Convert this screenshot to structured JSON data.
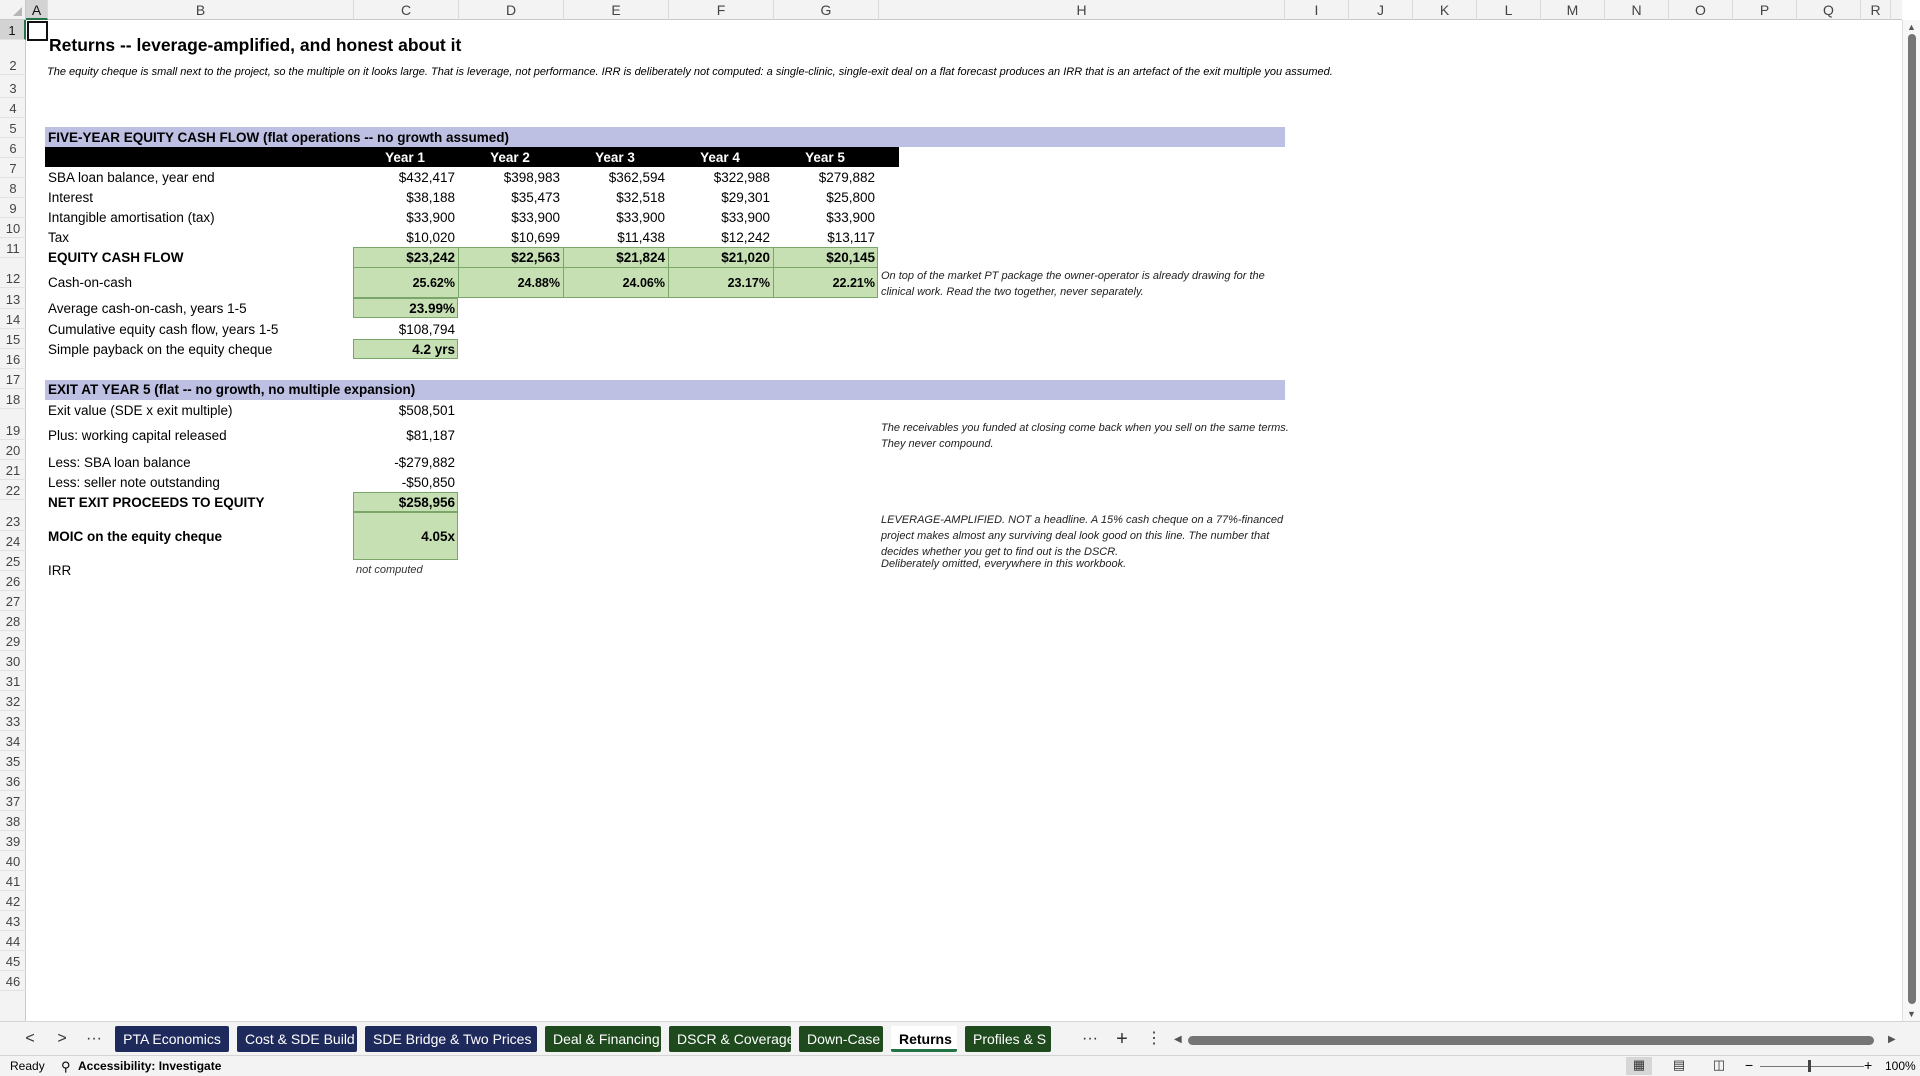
{
  "sheet": {
    "columns": [
      "A",
      "B",
      "C",
      "D",
      "E",
      "F",
      "G",
      "H",
      "I",
      "J",
      "K",
      "L",
      "M",
      "N",
      "O",
      "P",
      "Q",
      "R"
    ],
    "rows": [
      "1",
      "2",
      "3",
      "4",
      "5",
      "6",
      "7",
      "8",
      "9",
      "10",
      "11",
      "12",
      "13",
      "14",
      "15",
      "16",
      "17",
      "18",
      "19",
      "20",
      "21",
      "22",
      "23",
      "24",
      "25",
      "26",
      "27",
      "28",
      "29",
      "30",
      "31",
      "32",
      "33",
      "34",
      "35",
      "36",
      "37",
      "38",
      "39",
      "40",
      "41",
      "42",
      "43",
      "44",
      "45",
      "46"
    ],
    "title": "Returns -- leverage-amplified, and honest about it",
    "intro": "The equity cheque is small next to the project, so the multiple on it looks large. That is leverage, not performance. IRR is deliberately not computed: a single-clinic, single-exit deal on a flat forecast produces an IRR that is an artefact of the exit multiple you assumed.",
    "cash_flow": {
      "section_title": "FIVE-YEAR EQUITY CASH FLOW  (flat operations -- no growth assumed)",
      "years": [
        "Year 1",
        "Year 2",
        "Year 3",
        "Year 4",
        "Year 5"
      ],
      "rows": [
        {
          "label": "SBA loan balance, year end",
          "values": [
            "$432,417",
            "$398,983",
            "$362,594",
            "$322,988",
            "$279,882"
          ]
        },
        {
          "label": "Interest",
          "values": [
            "$38,188",
            "$35,473",
            "$32,518",
            "$29,301",
            "$25,800"
          ]
        },
        {
          "label": "Intangible amortisation (tax)",
          "values": [
            "$33,900",
            "$33,900",
            "$33,900",
            "$33,900",
            "$33,900"
          ]
        },
        {
          "label": "Tax",
          "values": [
            "$10,020",
            "$10,699",
            "$11,438",
            "$12,242",
            "$13,117"
          ]
        },
        {
          "label": "EQUITY CASH FLOW",
          "values": [
            "$23,242",
            "$22,563",
            "$21,824",
            "$21,020",
            "$20,145"
          ]
        },
        {
          "label": "Cash-on-cash",
          "values": [
            "25.62%",
            "24.88%",
            "24.06%",
            "23.17%",
            "22.21%"
          ]
        }
      ],
      "coc_note": "On top of the market PT package the owner-operator is already drawing for the clinical work. Read the two together, never separately.",
      "avg_label": "Average cash-on-cash, years 1-5",
      "avg_value": "23.99%",
      "cum_label": "Cumulative equity cash flow, years 1-5",
      "cum_value": "$108,794",
      "payback_label": "Simple payback on the equity cheque",
      "payback_value": "4.2 yrs"
    },
    "exit": {
      "section_title": "EXIT AT YEAR 5  (flat -- no growth, no multiple expansion)",
      "exit_value_label": "Exit value (SDE x exit multiple)",
      "exit_value": "$508,501",
      "wc_label": "Plus: working capital released",
      "wc_value": "$81,187",
      "wc_note": "The receivables you funded at closing come back when you sell on the same terms. They never compound.",
      "sba_label": "Less: SBA loan balance",
      "sba_value": "-$279,882",
      "seller_label": "Less: seller note outstanding",
      "seller_value": "-$50,850",
      "net_label": "NET EXIT PROCEEDS TO EQUITY",
      "net_value": "$258,956",
      "moic_label": "MOIC on the equity cheque",
      "moic_value": "4.05x",
      "moic_note": "LEVERAGE-AMPLIFIED. NOT a headline. A 15% cash cheque on a 77%-financed project makes almost any surviving deal look good on this line. The number that decides whether you get to find out is the DSCR.",
      "irr_label": "IRR",
      "irr_value": "not computed",
      "irr_note": "Deliberately omitted, everywhere in this workbook."
    }
  },
  "tabs": [
    {
      "label": "PTA Economics",
      "color": "#1f2a5c"
    },
    {
      "label": "Cost & SDE Build",
      "color": "#1f2a5c"
    },
    {
      "label": "SDE Bridge & Two Prices",
      "color": "#1f2a5c"
    },
    {
      "label": "Deal & Financing",
      "color": "#1e4a1e"
    },
    {
      "label": "DSCR & Coverage",
      "color": "#1e4a1e"
    },
    {
      "label": "Down-Case",
      "color": "#1e4a1e"
    },
    {
      "label": "Returns",
      "color": "#1e4a1e"
    },
    {
      "label": "Profiles & S",
      "color": "#1e4a1e"
    }
  ],
  "tab_nav": {
    "prev": "<",
    "next": ">",
    "more_left": "···",
    "more_right": "···",
    "add": "+",
    "options": "⋮"
  },
  "status": {
    "ready": "Ready",
    "accessibility": "Accessibility: Investigate",
    "zoom": "100%",
    "zoom_minus": "−",
    "zoom_plus": "+"
  }
}
